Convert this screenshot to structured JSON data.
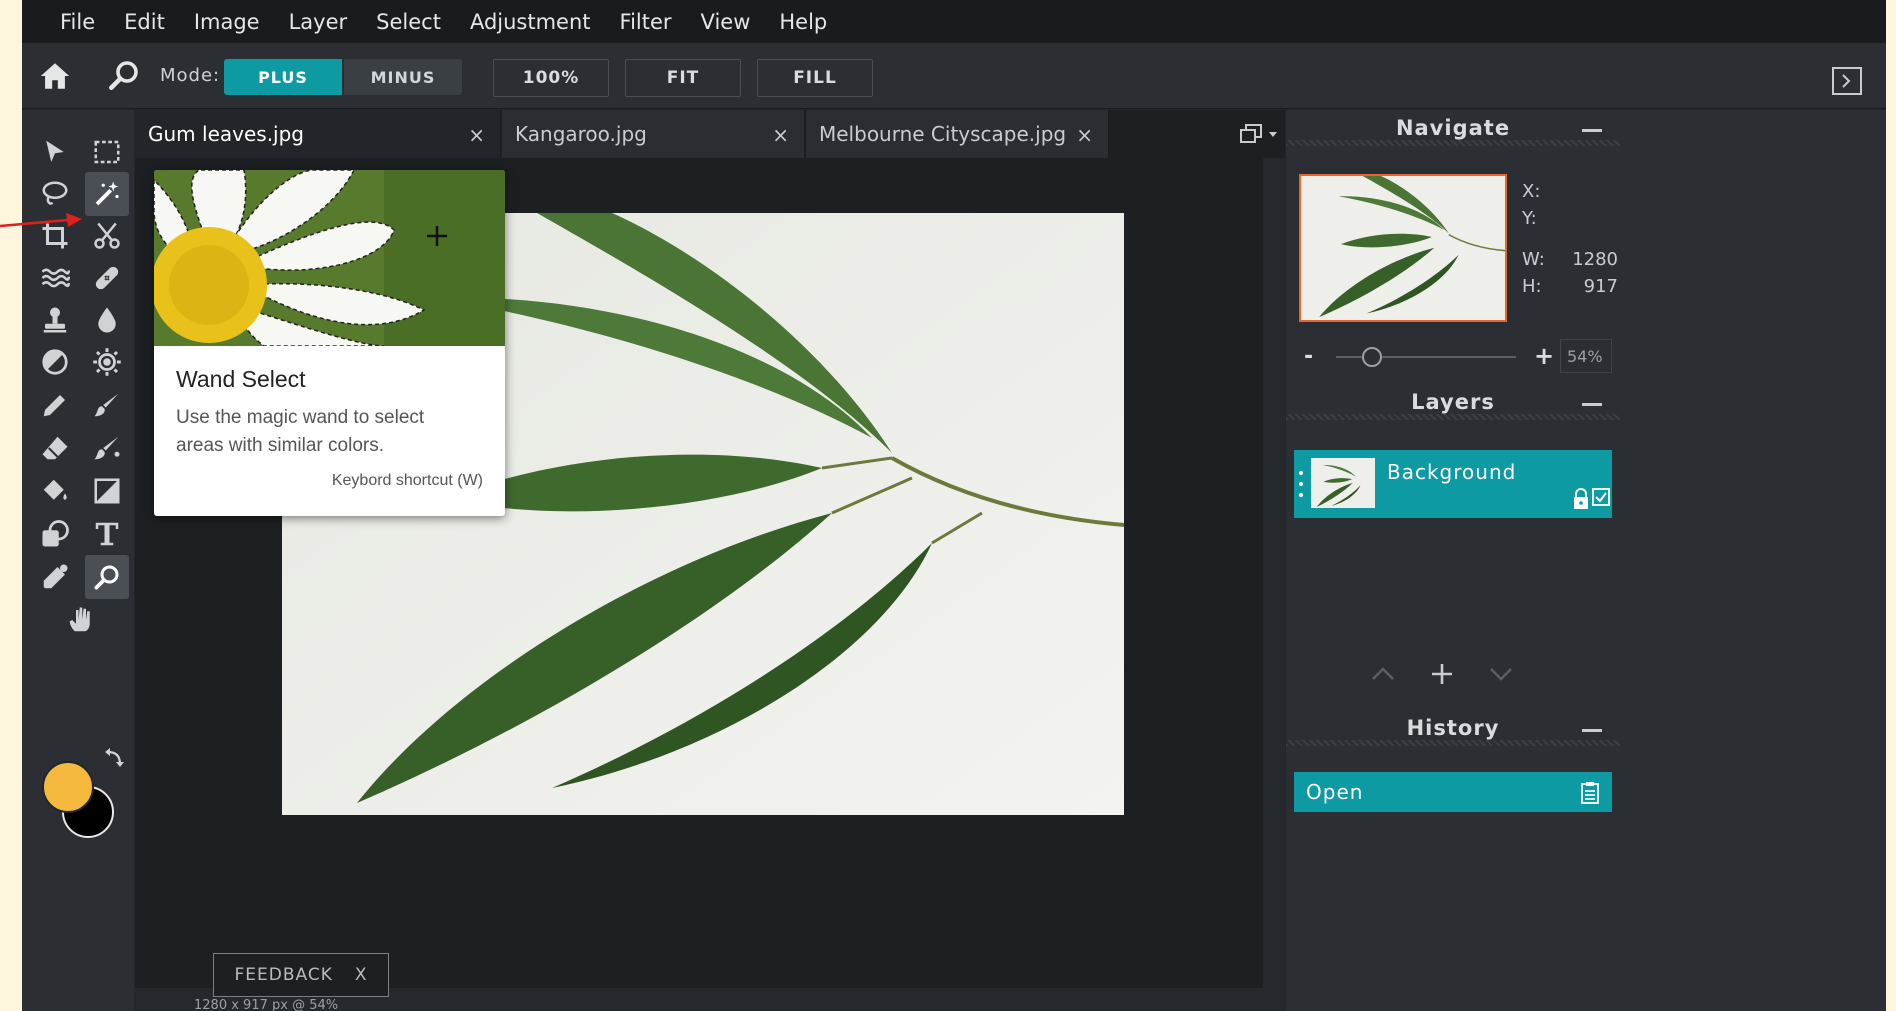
{
  "menu": [
    "File",
    "Edit",
    "Image",
    "Layer",
    "Select",
    "Adjustment",
    "Filter",
    "View",
    "Help"
  ],
  "toolbar": {
    "mode_label": "Mode:",
    "plus_label": "PLUS",
    "minus_label": "MINUS",
    "zoom100_label": "100%",
    "fit_label": "FIT",
    "fill_label": "FILL"
  },
  "tabs": [
    {
      "label": "Gum leaves.jpg",
      "close": "×"
    },
    {
      "label": "Kangaroo.jpg",
      "close": "×"
    },
    {
      "label": "Melbourne Cityscape.jpg",
      "close": "×"
    }
  ],
  "tooltip": {
    "title": "Wand Select",
    "description": "Use the magic wand to select areas with similar colors.",
    "shortcut": "Keybord shortcut (W)"
  },
  "feedback": {
    "label": "FEEDBACK",
    "close": "X"
  },
  "status": "1280 x 917 px @ 54%",
  "navigate": {
    "title": "Navigate",
    "x_label": "X:",
    "x_value": "",
    "y_label": "Y:",
    "y_value": "",
    "w_label": "W:",
    "w_value": "1280",
    "h_label": "H:",
    "h_value": "917",
    "zoom_minus": "-",
    "zoom_plus": "+",
    "zoom_value": "54%",
    "zoom_fraction": 0.2
  },
  "layers": {
    "title": "Layers",
    "items": [
      {
        "name": "Background"
      }
    ]
  },
  "history": {
    "title": "History",
    "items": [
      {
        "name": "Open"
      }
    ]
  },
  "colors": {
    "accent": "#0e9aa2",
    "foreground": "#f4b93d",
    "background": "#000000"
  },
  "icons": {
    "tools": [
      "move-icon",
      "marquee-select-icon",
      "lasso-icon",
      "magic-wand-icon",
      "crop-icon",
      "cut-icon",
      "liquify-icon",
      "heal-icon",
      "clone-stamp-icon",
      "blur-icon",
      "dodge-icon",
      "sponge-icon",
      "pencil-icon",
      "brush-icon",
      "eraser-icon",
      "color-replace-icon",
      "fill-bucket-icon",
      "gradient-icon",
      "shape-icon",
      "text-icon",
      "eyedropper-icon",
      "zoom-icon",
      "hand-icon"
    ]
  }
}
